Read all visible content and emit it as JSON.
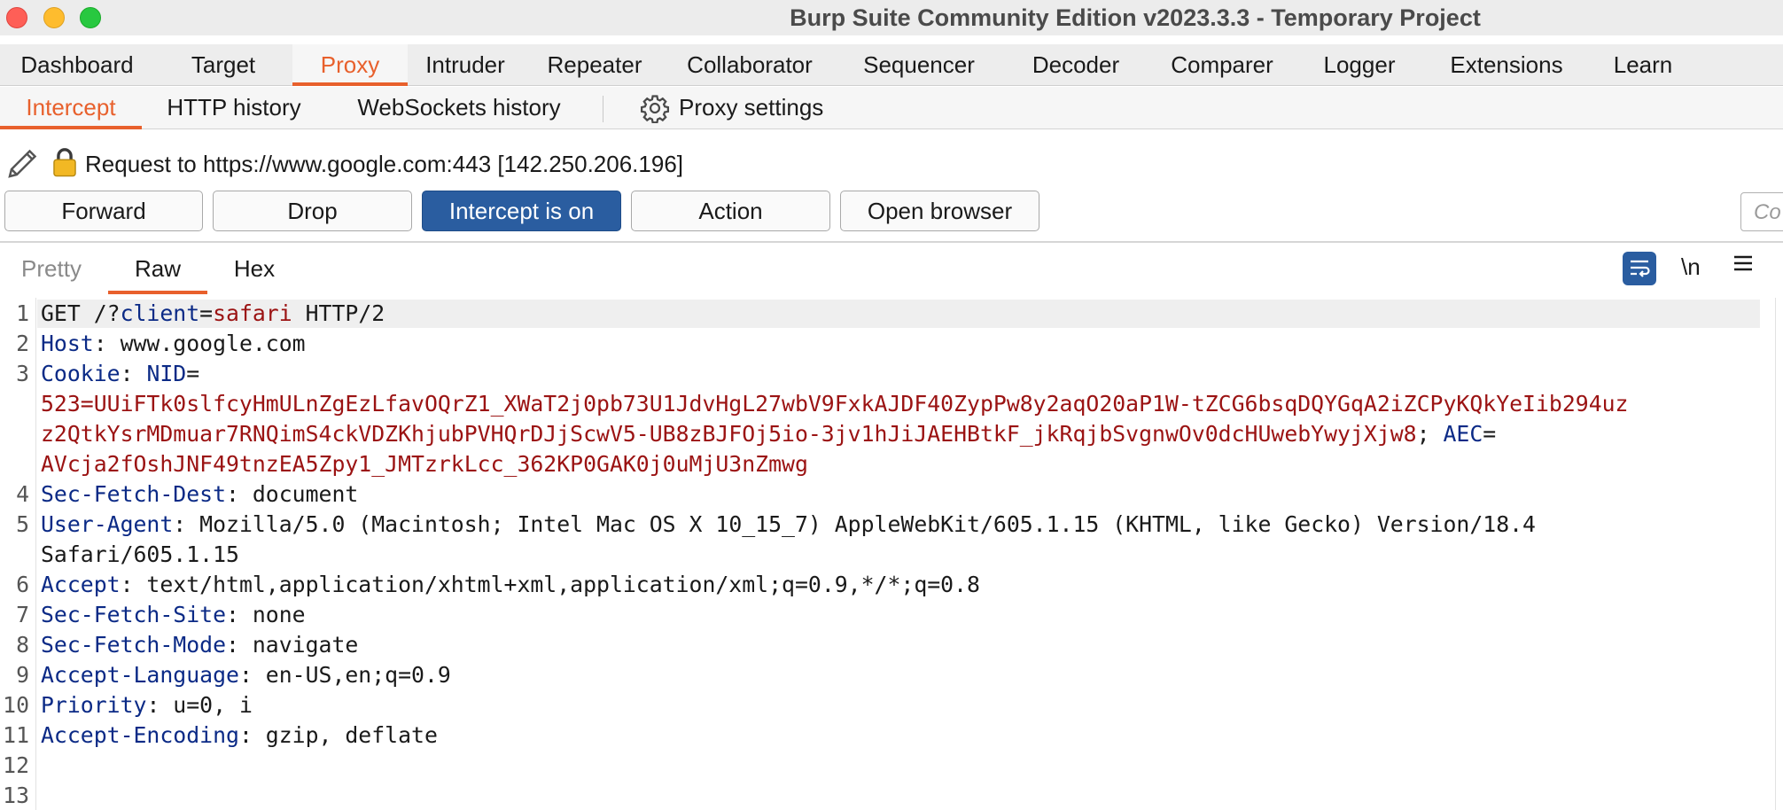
{
  "window": {
    "title": "Burp Suite Community Edition v2023.3.3 - Temporary Project"
  },
  "main_tabs": [
    {
      "label": "Dashboard"
    },
    {
      "label": "Target"
    },
    {
      "label": "Proxy",
      "active": true
    },
    {
      "label": "Intruder"
    },
    {
      "label": "Repeater"
    },
    {
      "label": "Collaborator"
    },
    {
      "label": "Sequencer"
    },
    {
      "label": "Decoder"
    },
    {
      "label": "Comparer"
    },
    {
      "label": "Logger"
    },
    {
      "label": "Extensions"
    },
    {
      "label": "Learn"
    }
  ],
  "sub_tabs": [
    {
      "label": "Intercept",
      "active": true
    },
    {
      "label": "HTTP history"
    },
    {
      "label": "WebSockets history"
    }
  ],
  "proxy_settings": {
    "label": "Proxy settings",
    "icon": "gear-icon"
  },
  "request": {
    "line": "Request to https://www.google.com:443  [142.250.206.196]",
    "icons": [
      "pencil-icon",
      "lock-icon"
    ]
  },
  "buttons": {
    "forward": "Forward",
    "drop": "Drop",
    "intercept": "Intercept is on",
    "action": "Action",
    "open_browser": "Open browser"
  },
  "comment_field": {
    "placeholder": "Co"
  },
  "view_tabs": [
    {
      "label": "Pretty"
    },
    {
      "label": "Raw",
      "active": true
    },
    {
      "label": "Hex"
    }
  ],
  "editor_tools": {
    "wrap_icon": "word-wrap-icon",
    "newline_label": "\\n",
    "menu_icon": "hamburger-menu-icon"
  },
  "code": {
    "line_numbers": [
      "1",
      "2",
      "3",
      "4",
      "5",
      "6",
      "7",
      "8",
      "9",
      "10",
      "11",
      "12",
      "13"
    ],
    "l1": {
      "method": "GET /?",
      "param": "client",
      "eq": "=",
      "value": "safari",
      "proto": " HTTP/2"
    },
    "l2": {
      "key": "Host",
      "val": ": www.google.com"
    },
    "l3": {
      "key": "Cookie",
      "sep": ": ",
      "k2": "NID",
      "eq": "="
    },
    "l3b": "523=UUiFTk0slfcyHmULnZgEzLfavOQrZ1_XWaT2j0pb73U1JdvHgL27wbV9FxkAJDF40ZypPw8y2aqO20aP1W-tZCG6bsqDQYGqA2iZCPyKQkYeIib294uz",
    "l3c": {
      "val": "z2QtkYsrMDmuar7RNQimS4ckVDZKhjubPVHQrDJjScwV5-UB8zBJFOj5io-3jv1hJiJAEHBtkF_jkRqjbSvgnwOv0dcHUwebYwyjXjw8",
      "semi": "; ",
      "key": "AEC",
      "eq": "="
    },
    "l3d": "AVcja2fOshJNF49tnzEA5Zpy1_JMTzrkLcc_362KP0GAK0j0uMjU3nZmwg",
    "l4": {
      "key": "Sec-Fetch-Dest",
      "val": ": document"
    },
    "l5": {
      "key": "User-Agent",
      "val": ": Mozilla/5.0 (Macintosh; Intel Mac OS X 10_15_7) AppleWebKit/605.1.15 (KHTML, like Gecko) Version/18.4"
    },
    "l5b": "Safari/605.1.15",
    "l6": {
      "key": "Accept",
      "val": ": text/html,application/xhtml+xml,application/xml;q=0.9,*/*;q=0.8"
    },
    "l7": {
      "key": "Sec-Fetch-Site",
      "val": ": none"
    },
    "l8": {
      "key": "Sec-Fetch-Mode",
      "val": ": navigate"
    },
    "l9": {
      "key": "Accept-Language",
      "val": ": en-US,en;q=0.9"
    },
    "l10": {
      "key": "Priority",
      "val": ": u=0, i"
    },
    "l11": {
      "key": "Accept-Encoding",
      "val": ": gzip, deflate"
    }
  }
}
